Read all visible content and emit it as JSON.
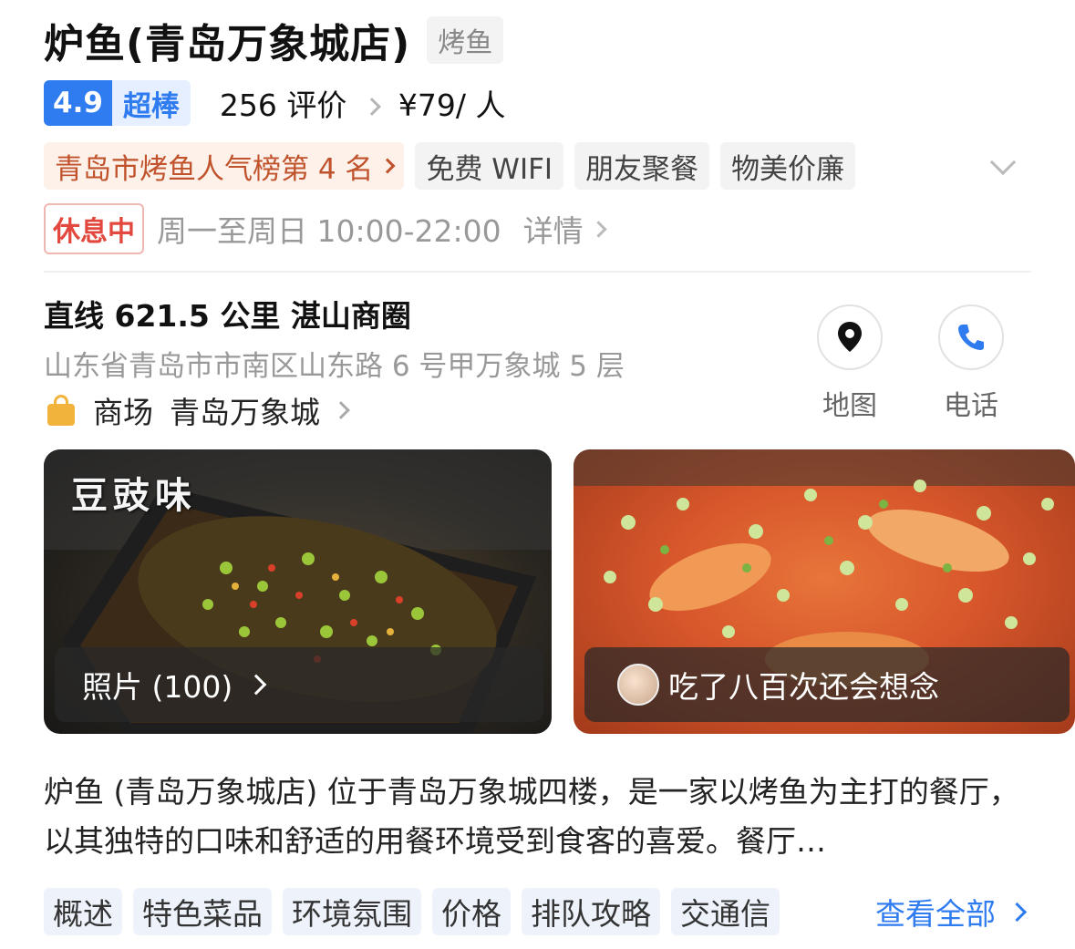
{
  "header": {
    "title": "炉鱼(青岛万象城店)",
    "category": "烤鱼"
  },
  "rating": {
    "score": "4.9",
    "label": "超棒",
    "reviews": "256 评价",
    "price": "¥79/ 人"
  },
  "tags": {
    "rank": "青岛市烤鱼人气榜第 4 名",
    "items": [
      "免费 WIFI",
      "朋友聚餐",
      "物美价廉"
    ]
  },
  "hours": {
    "status": "休息中",
    "time": "周一至周日 10:00-22:00",
    "detail": "详情"
  },
  "location": {
    "distance": "直线 621.5 公里  湛山商圈",
    "address": "山东省青岛市市南区山东路 6 号甲万象城 5 层",
    "mall_type": "商场",
    "mall_name": "青岛万象城"
  },
  "actions": {
    "map": "地图",
    "phone": "电话"
  },
  "photos": {
    "left_overlay_text": "豆豉味",
    "count_label": "照片 (100)",
    "review_snippet": "吃了八百次还会想念"
  },
  "description": "炉鱼 (青岛万象城店) 位于青岛万象城四楼，是一家以烤鱼为主打的餐厅，以其独特的口味和舒适的用餐环境受到食客的喜爱。餐厅…",
  "bottom_tabs": [
    "概述",
    "特色菜品",
    "环境氛围",
    "价格",
    "排队攻略",
    "交通信"
  ],
  "see_all": "查看全部",
  "colors": {
    "accent": "#2f7bf0",
    "closed_red": "#e2483d",
    "rank_orange": "#c0532b",
    "bag_yellow": "#f2b33d"
  }
}
